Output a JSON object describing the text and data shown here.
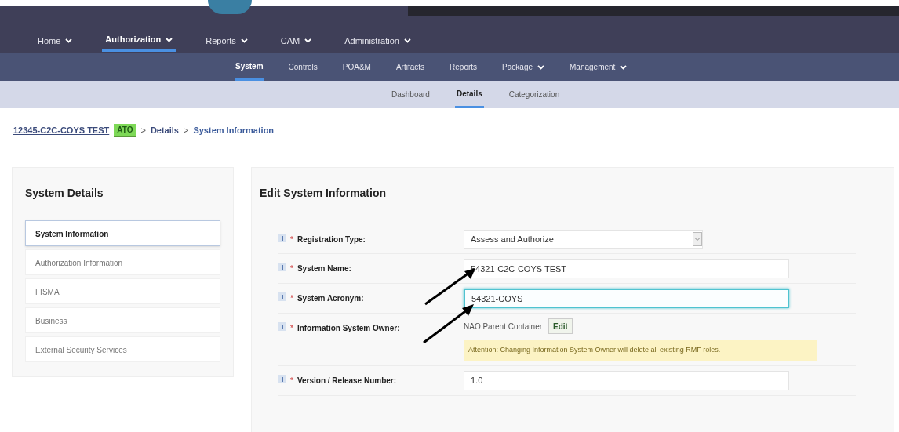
{
  "main_nav": [
    {
      "label": "Home",
      "selected": false
    },
    {
      "label": "Authorization",
      "selected": true
    },
    {
      "label": "Reports",
      "selected": false
    },
    {
      "label": "CAM",
      "selected": false
    },
    {
      "label": "Administration",
      "selected": false
    }
  ],
  "sub_nav": [
    {
      "label": "System",
      "selected": true,
      "dropdown": false
    },
    {
      "label": "Controls",
      "selected": false,
      "dropdown": false
    },
    {
      "label": "POA&M",
      "selected": false,
      "dropdown": false
    },
    {
      "label": "Artifacts",
      "selected": false,
      "dropdown": false
    },
    {
      "label": "Reports",
      "selected": false,
      "dropdown": false
    },
    {
      "label": "Package",
      "selected": false,
      "dropdown": true
    },
    {
      "label": "Management",
      "selected": false,
      "dropdown": true
    }
  ],
  "page_tabs": [
    {
      "label": "Dashboard",
      "selected": false
    },
    {
      "label": "Details",
      "selected": true
    },
    {
      "label": "Categorization",
      "selected": false
    }
  ],
  "breadcrumb": {
    "system": "12345-C2C-COYS TEST",
    "badge": "ATO",
    "separator_1": ">",
    "details": "Details",
    "separator_2": ">",
    "current": "System Information"
  },
  "sidebar": {
    "title": "System Details",
    "items": [
      {
        "label": "System Information",
        "selected": true
      },
      {
        "label": "Authorization Information",
        "selected": false
      },
      {
        "label": "FISMA",
        "selected": false
      },
      {
        "label": "Business",
        "selected": false
      },
      {
        "label": "External Security Services",
        "selected": false
      }
    ]
  },
  "form": {
    "title": "Edit System Information",
    "fields": [
      {
        "kind": "select",
        "required": "*",
        "label": "Registration Type:",
        "value": "Assess and Authorize"
      },
      {
        "kind": "text",
        "required": "*",
        "label": "System Name:",
        "value": "54321-C2C-COYS TEST",
        "focused": false
      },
      {
        "kind": "text",
        "required": "*",
        "label": "System Acronym:",
        "value": "54321-COYS",
        "focused": true
      },
      {
        "kind": "owner",
        "required": "*",
        "label": "Information System Owner:",
        "value": "NAO Parent Container",
        "button": "Edit",
        "warning": "Attention: Changing Information System Owner will delete all existing RMF roles."
      },
      {
        "kind": "text",
        "required": "*",
        "label": "Version / Release Number:",
        "value": "1.0",
        "focused": false
      }
    ]
  }
}
